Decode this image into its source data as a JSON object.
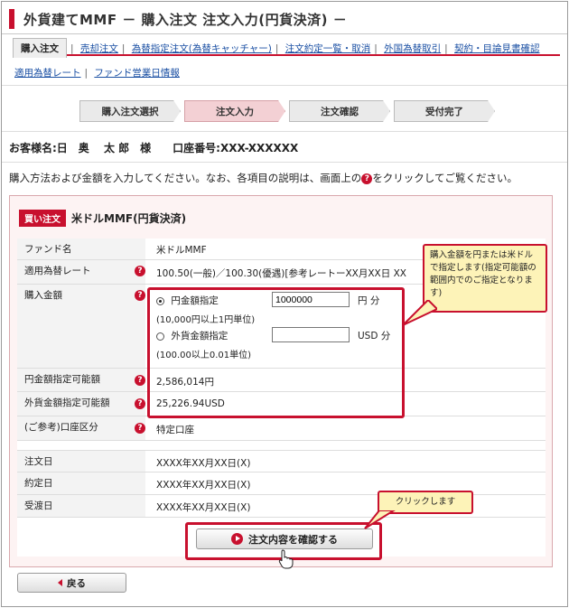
{
  "header": {
    "title": "外貨建てMMF － 購入注文 注文入力(円貨決済) －"
  },
  "nav": {
    "active": "購入注文",
    "links": [
      "売却注文",
      "為替指定注文(為替キャッチャー)",
      "注文約定一覧・取消",
      "外国為替取引",
      "契約・目論見書確認"
    ],
    "links2": [
      "適用為替レート",
      "ファンド営業日情報"
    ]
  },
  "steps": [
    "購入注文選択",
    "注文入力",
    "注文確認",
    "受付完了"
  ],
  "customer": {
    "line": "お客様名:日　奥　 太 郎　様　　口座番号:XXX-XXXXXX"
  },
  "instructions": {
    "before": "購入方法および金額を入力してください。なお、各項目の説明は、画面上の",
    "icon": "?",
    "after": "をクリックしてご覧ください。"
  },
  "panel": {
    "badge": "買い注文",
    "title": "米ドルMMF(円貨決済)"
  },
  "fields": {
    "fund_label": "ファンド名",
    "fund_value": "米ドルMMF",
    "rate_label": "適用為替レート",
    "rate_value": "100.50(一般)／100.30(優遇)[参考レートーXX月XX日 XX",
    "amount_label": "購入金額",
    "yen_option": "円金額指定",
    "yen_value": "1000000",
    "yen_unit": "円 分",
    "yen_note": "(10,000円以上1円単位)",
    "fx_option": "外貨金額指定",
    "fx_value": "",
    "fx_unit": "USD 分",
    "fx_note": "(100.00以上0.01単位)",
    "yen_avail_label": "円金額指定可能額",
    "yen_avail_value": "2,586,014円",
    "fx_avail_label": "外貨金額指定可能額",
    "fx_avail_value": "25,226.94USD",
    "acct_label": "(ご参考)口座区分",
    "acct_value": "特定口座",
    "order_date_label": "注文日",
    "order_date_value": "XXXX年XX月XX日(X)",
    "exec_date_label": "約定日",
    "exec_date_value": "XXXX年XX月XX日(X)",
    "settle_date_label": "受渡日",
    "settle_date_value": "XXXX年XX月XX日(X)"
  },
  "callouts": {
    "amount": "購入金額を円または米ドルで指定します(指定可能額の範囲内でのご指定となります)",
    "click": "クリックします"
  },
  "buttons": {
    "confirm": "注文内容を確認する",
    "back": "戻る"
  },
  "colors": {
    "accent": "#c8102e",
    "callout_bg": "#fdf3b8",
    "current_step": "#f3d0d4"
  }
}
